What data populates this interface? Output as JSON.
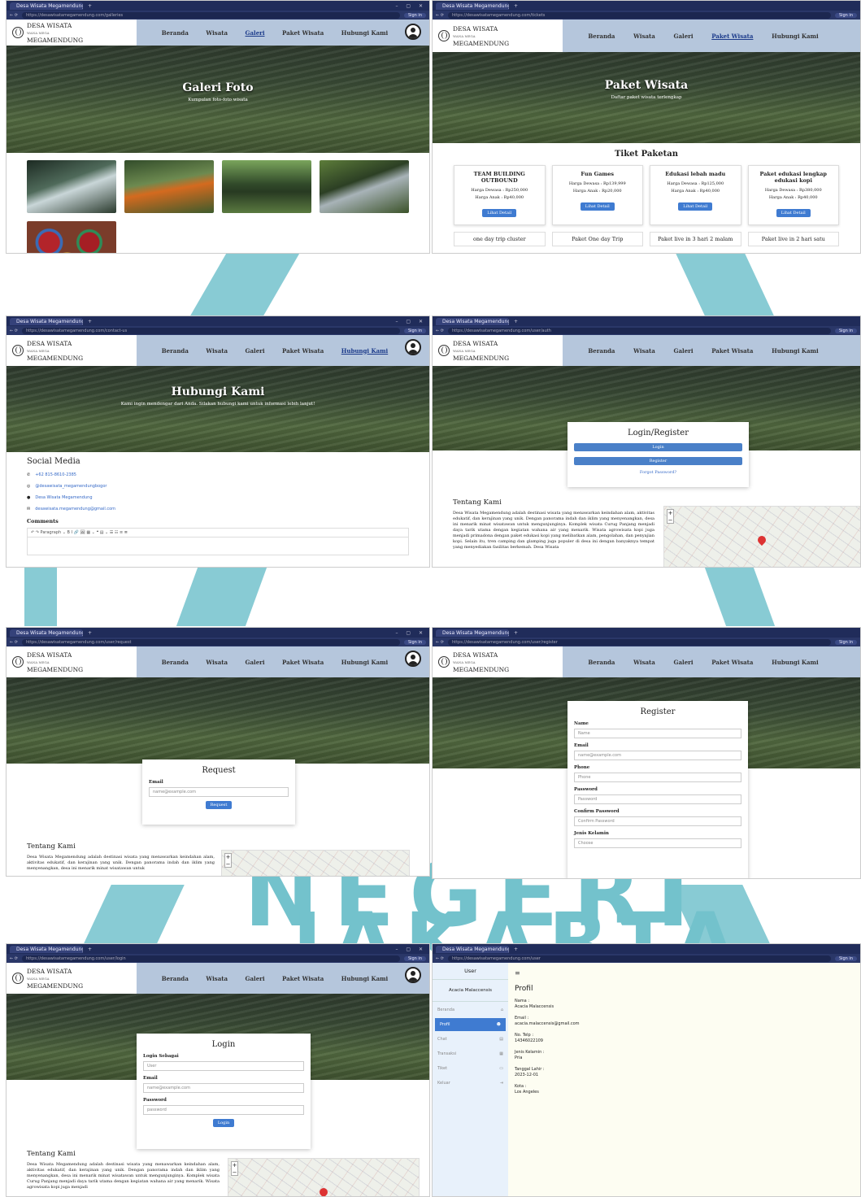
{
  "browser": {
    "tab_title": "Desa Wisata Megamendung",
    "signin": "Sign in",
    "urls": {
      "galeri": "https://desawisatamegamendung.com/galleries",
      "tiket": "https://desawisatamegamendung.com/tickets",
      "kontak": "https://desawisatamegamendung.com/contact-us",
      "auth": "https://desawisatamegamendung.com/user/auth",
      "request": "https://desawisatamegamendung.com/user/request",
      "register": "https://desawisatamegamendung.com/user/register",
      "login": "https://desawisatamegamendung.com/user/login",
      "user": "https://desawisatamegamendung.com/user"
    }
  },
  "brand": {
    "line1": "DESA WISATA",
    "line2": "MEGAMENDUNG",
    "tag": "WANA MEGA"
  },
  "nav": {
    "beranda": "Beranda",
    "wisata": "Wisata",
    "galeri": "Galeri",
    "paket": "Paket Wisata",
    "hubungi": "Hubungi Kami"
  },
  "galeri": {
    "title": "Galeri Foto",
    "subtitle": "Kumpulan foto-foto wisata"
  },
  "paket": {
    "title": "Paket Wisata",
    "subtitle": "Daftar paket wisata terlengkap",
    "section": "Tiket Paketan",
    "cards": [
      {
        "name": "TEAM BUILDING OUTBOUND",
        "adult": "Harga Dewasa : Rp250,000",
        "child": "Harga Anak : Rp40,000",
        "btn": "Lihat Detail"
      },
      {
        "name": "Fun Games",
        "adult": "Harga Dewasa : Rp139,999",
        "child": "Harga Anak : Rp20,000",
        "btn": "Lihat Detail"
      },
      {
        "name": "Edukasi lebah madu",
        "adult": "Harga Dewasa : Rp125,000",
        "child": "Harga Anak : Rp40,000",
        "btn": "Lihat Detail"
      },
      {
        "name": "Paket edukasi lengkap edukasi kopi",
        "adult": "Harga Dewasa : Rp380,000",
        "child": "Harga Anak : Rp40,000",
        "btn": "Lihat Detail"
      }
    ],
    "more": [
      "one day trip cluster",
      "Paket One day Trip",
      "Paket live in 3 hari 2 malam",
      "Paket live in 2 hari satu"
    ]
  },
  "kontak": {
    "title": "Hubungi Kami",
    "subtitle": "Kami ingin mendengar dari Anda. Silakan hubungi kami untuk informasi lebih lanjut!",
    "social_title": "Social Media",
    "phone": "+62 815-8610-2385",
    "ig": "@desawisata_megamendungbogor",
    "fb": "Desa Wisata Megamendung",
    "email": "desawisata.megamendung@gmail.com",
    "comments": "Comments",
    "toolbar": "↶  ↷   Paragraph   ⌄   B   I   🔗  🖼  ▦ ⌄  ❝  ▤ ⌄  ☰  ☷  ≡  ≣"
  },
  "auth": {
    "title": "Login/Register",
    "login": "Login",
    "register": "Register",
    "forgot": "Forgot Password?"
  },
  "about": {
    "title": "Tentang Kami",
    "text": "Desa Wisata Megamendung adalah destinasi wisata yang menawarkan keindahan alam, aktivitas edukatif, dan kerajinan yang unik. Dengan panorama indah dan iklim yang menyenangkan, desa ini menarik minat wisatawan untuk mengunjunginya. Komplek wisata Curug Panjang menjadi daya tarik utama dengan kegiatan wahana air yang menarik. Wisata agrowisata kopi juga menjadi primadona dengan paket edukasi kopi yang melibatkan alam, pengolahan, dan penyajian kopi. Selain itu, tren camping dan glamping juga populer di desa ini dengan banyaknya tempat yang menyediakan fasilitas berkemah. Desa Wisata",
    "text_short": "Desa Wisata Megamendung adalah destinasi wisata yang menawarkan keindahan alam, aktivitas edukatif, dan kerajinan yang unik. Dengan panorama indah dan iklim yang menyenangkan, desa ini menarik minat wisatawan untuk",
    "text_login": "Desa Wisata Megamendung adalah destinasi wisata yang menawarkan keindahan alam, aktivitas edukatif, dan kerajinan yang unik. Dengan panorama indah dan iklim yang menyenangkan, desa ini menarik minat wisatawan untuk mengunjunginya. Komplek wisata Curug Panjang menjadi daya tarik utama dengan kegiatan wahana air yang menarik. Wisata agrowisata kopi juga menjadi"
  },
  "request": {
    "title": "Request",
    "email_label": "Email",
    "email_ph": "name@example.com",
    "btn": "Request"
  },
  "register": {
    "title": "Register",
    "name_label": "Name",
    "name_ph": "Name",
    "email_label": "Email",
    "email_ph": "name@example.com",
    "phone_label": "Phone",
    "phone_ph": "Phone",
    "pass_label": "Password",
    "pass_ph": "Password",
    "confirm_label": "Confirm Password",
    "confirm_ph": "Confirm Password",
    "gender_label": "Jenis Kelamin",
    "gender_value": "Choose"
  },
  "login": {
    "title": "Login",
    "role_label": "Login Sebagai",
    "role_value": "User",
    "email_label": "Email",
    "email_ph": "name@example.com",
    "pass_label": "Password",
    "pass_ph": "password",
    "btn": "Login"
  },
  "user": {
    "header": "User",
    "name": "Acacia Malaccensis",
    "menu": [
      "Beranda",
      "Profil",
      "Chat",
      "Transaksi",
      "Tiket",
      "Keluar"
    ],
    "profile_title": "Profil",
    "fields": [
      {
        "label": "Nama :",
        "value": "Acacia Malaccensis"
      },
      {
        "label": "Email :",
        "value": "acacia.malaccensis@gmail.com"
      },
      {
        "label": "No. Telp :",
        "value": "14346022109"
      },
      {
        "label": "Jenis Kelamin :",
        "value": "Pria"
      },
      {
        "label": "Tanggal Lahir :",
        "value": "2023-12-01"
      },
      {
        "label": "Kota :",
        "value": "Los Angeles"
      }
    ]
  },
  "watermark": {
    "line1": "NEGERI",
    "line2": "JAKARTA"
  },
  "colors": {
    "primary": "#3f7bd1",
    "nav": "#b5c6dc",
    "titlebar": "#202c5a",
    "watermark": "#73c2cc"
  }
}
